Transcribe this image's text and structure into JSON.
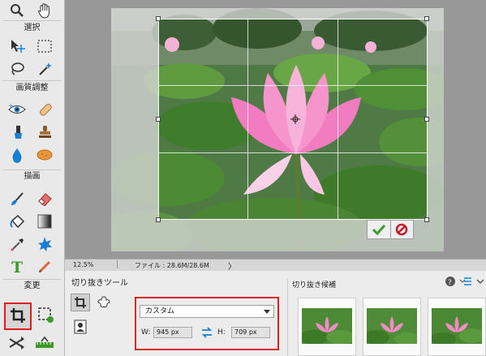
{
  "toolbox": {
    "sections": {
      "select": "選択",
      "enhance": "画質調整",
      "draw": "描画",
      "modify": "変更"
    }
  },
  "status_bar": {
    "zoom": "12.5%",
    "file_info": "ファイル : 28.6M/28.6M",
    "nav_arrow": "〉"
  },
  "options_bar": {
    "tool_title": "切り抜きツール",
    "aspect_preset": "カスタム",
    "width_label": "W:",
    "width_value": "945 px",
    "height_label": "H:",
    "height_value": "709 px",
    "candidates_title": "切り抜き候補"
  },
  "colors": {
    "highlight": "#e31b1b",
    "confirm_green": "#3c9a2b",
    "cancel_red": "#c2192f",
    "swap_blue": "#1a7fd3"
  },
  "icons": [
    "zoom-icon",
    "hand-icon",
    "move-icon",
    "marquee-icon",
    "lasso-icon",
    "magic-wand-icon",
    "red-eye-icon",
    "spot-healing-icon",
    "smart-brush-icon",
    "clone-stamp-icon",
    "blur-icon",
    "sponge-icon",
    "brush-icon",
    "eraser-icon",
    "paint-bucket-icon",
    "gradient-icon",
    "eyedropper-icon",
    "custom-shape-icon",
    "type-icon",
    "pencil-icon",
    "crop-icon",
    "recompose-icon",
    "straighten-icon",
    "content-aware-move-icon"
  ]
}
